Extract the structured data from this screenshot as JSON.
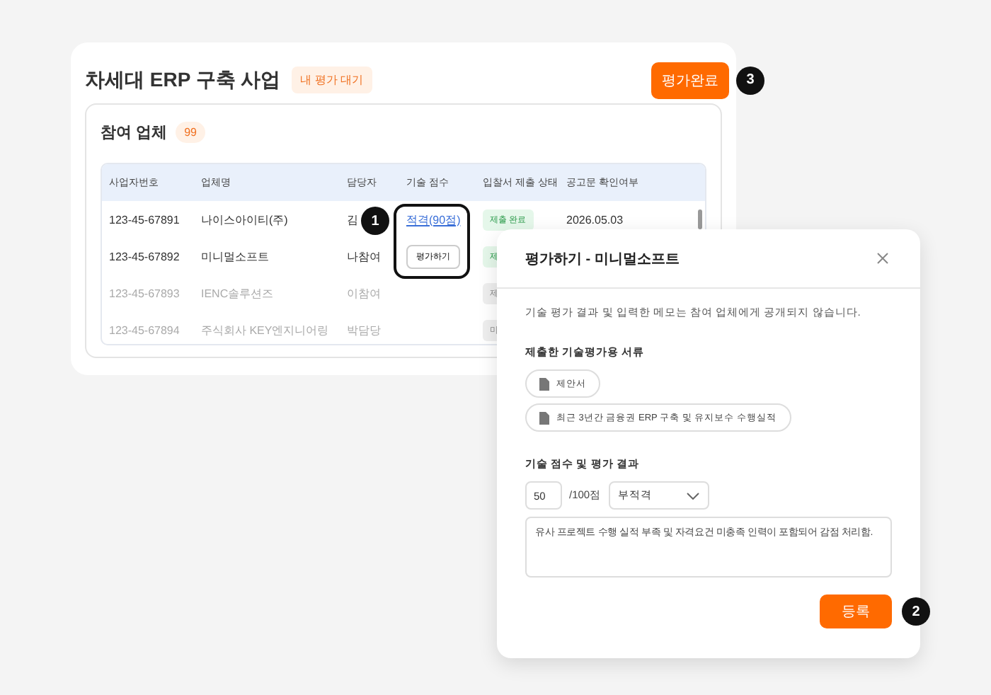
{
  "project": {
    "title": "차세대 ERP 구축 사업",
    "status_badge": "내 평가 대기",
    "complete_button": "평가완료",
    "callout": "3"
  },
  "participants": {
    "title": "참여 업체",
    "count": "99",
    "callout": "1",
    "columns": [
      "사업자번호",
      "업체명",
      "담당자",
      "기술 점수",
      "입찰서 제출 상태",
      "공고문 확인여부"
    ],
    "rows": [
      {
        "biz_no": "123-45-67891",
        "name": "나이스아이티(주)",
        "manager": "김",
        "score": {
          "kind": "link",
          "text": "적격(90점)"
        },
        "status": {
          "kind": "submitted",
          "text": "제출 완료"
        },
        "date": "2026.05.03",
        "disabled": false
      },
      {
        "biz_no": "123-45-67892",
        "name": "미니멀소프트",
        "manager": "나참여",
        "score": {
          "kind": "button",
          "text": "평가하기"
        },
        "status": {
          "kind": "submitted",
          "text": "제"
        },
        "disabled": false
      },
      {
        "biz_no": "123-45-67893",
        "name": "IENC솔루션즈",
        "manager": "이참여",
        "score": {
          "kind": "none"
        },
        "status": {
          "kind": "other",
          "text": "제"
        },
        "disabled": true
      },
      {
        "biz_no": "123-45-67894",
        "name": "주식회사 KEY엔지니어링",
        "manager": "박담당",
        "score": {
          "kind": "none"
        },
        "status": {
          "kind": "other",
          "text": "미"
        },
        "disabled": true
      }
    ]
  },
  "modal": {
    "title": "평가하기 - 미니멀소프트",
    "notice": "기술 평가 결과 및 입력한 메모는 참여 업체에게 공개되지 않습니다.",
    "documents_label": "제출한 기술평가용 서류",
    "documents": [
      "제안서",
      "최근 3년간 금융권 ERP 구축 및 유지보수 수행실적"
    ],
    "score_label": "기술 점수 및 평가 결과",
    "score": "50",
    "score_suffix": "/100점",
    "result": "부적격",
    "memo": "유사 프로젝트 수행 실적 부족 및 자격요건 미충족 인력이 포함되어 감점 처리함.",
    "submit_button": "등록",
    "callout": "2"
  }
}
